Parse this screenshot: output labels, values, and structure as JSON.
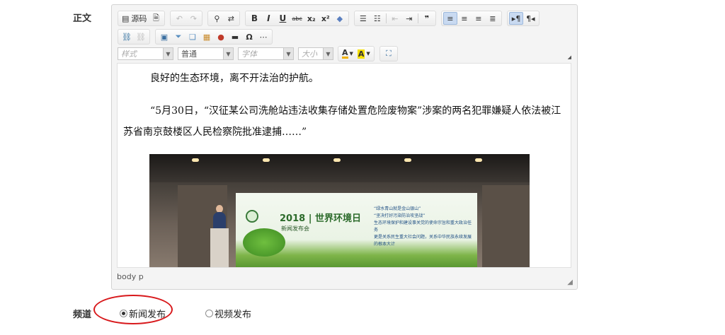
{
  "labels": {
    "body": "正文",
    "channel": "频道"
  },
  "toolbar": {
    "source": "源码",
    "bold": "B",
    "italic": "I",
    "underline": "U",
    "strike": "abc",
    "subscript": "x₂",
    "superscript": "x²",
    "style_combo": "样式",
    "format_combo": "普通",
    "font_combo": "字体",
    "size_combo": "大小",
    "text_color": "A",
    "bg_color": "A"
  },
  "content": {
    "paragraph1": "良好的生态环境，离不开法治的护航。",
    "paragraph2": "“5月30日，“汉征某公司洗舱站违法收集存储处置危险废物案”涉案的两名犯罪嫌疑人依法被江苏省南京鼓楼区人民检察院批准逮捕……”",
    "image": {
      "screen_title": "2018 | 世界环境日",
      "screen_subtitle": "新闻发布会",
      "bullets": [
        "“绿水青山就是金山银山”",
        "“坚决打好污染防治攻坚战”",
        "生态环境保护和建设事关党的使命宗旨和重大政治任务",
        "更是关系民生重大社会问题，关系中华民族永续发展的根本大计"
      ]
    }
  },
  "statusbar": {
    "path": "body  p"
  },
  "channel": {
    "options": [
      {
        "label": "新闻发布",
        "checked": true
      },
      {
        "label": "视频发布",
        "checked": false
      }
    ]
  },
  "colors": {
    "annotation": "#d8191c",
    "active_button": "#c9daf1"
  }
}
